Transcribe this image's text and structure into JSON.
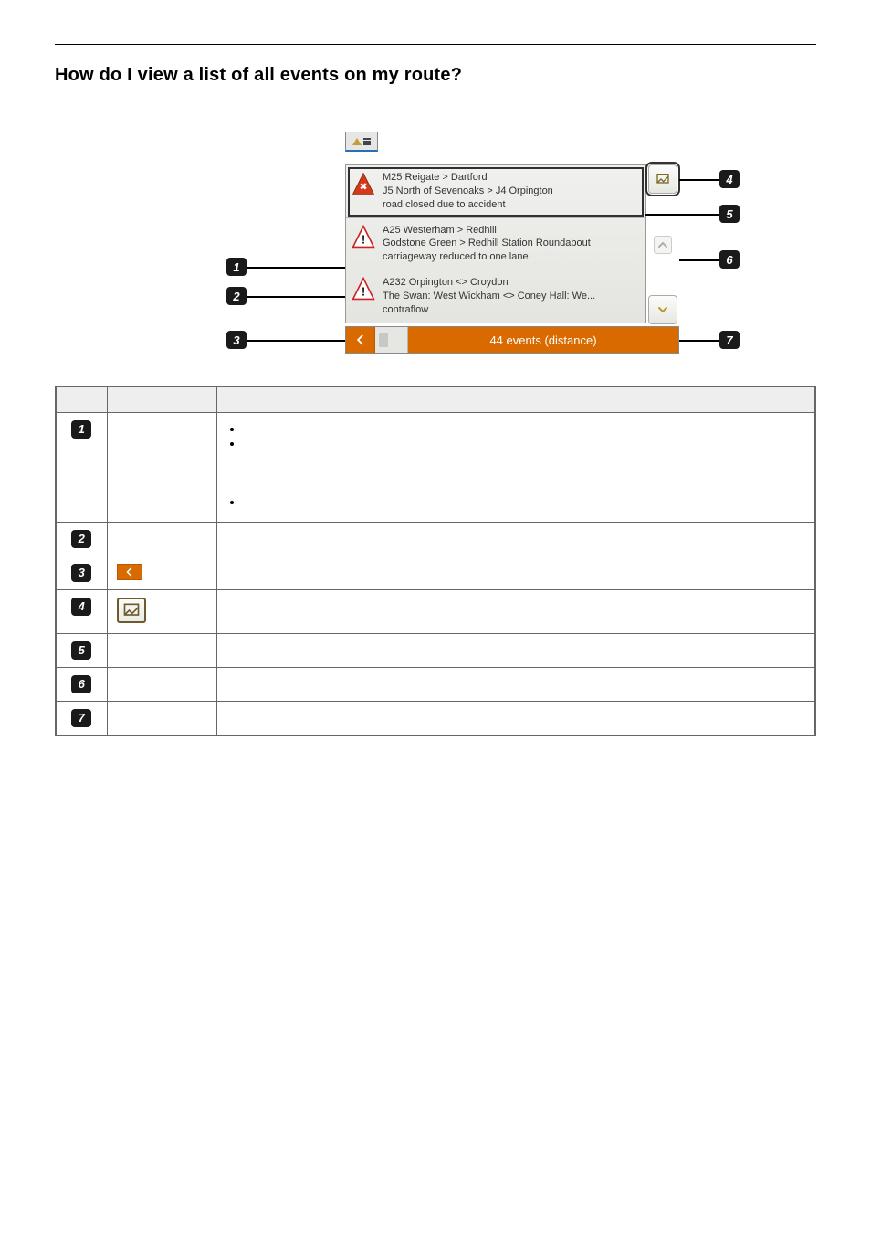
{
  "heading": "How do I view a list of all events on my route?",
  "events": [
    {
      "kind": "accident",
      "line1": "M25 Reigate > Dartford",
      "line2": "J5 North of Sevenoaks > J4 Orpington",
      "line3": "road closed due to accident"
    },
    {
      "kind": "warning",
      "line1": "A25 Westerham > Redhill",
      "line2": "Godstone Green > Redhill Station Roundabout",
      "line3": "carriageway reduced to one lane"
    },
    {
      "kind": "warning",
      "line1": "A232 Orpington <> Croydon",
      "line2": "The Swan: West Wickham <> Coney Hall: We...",
      "line3": "contraflow"
    }
  ],
  "status_text": "44 events (distance)",
  "callouts": [
    "1",
    "2",
    "3",
    "4",
    "5",
    "6",
    "7"
  ],
  "legend_rows": [
    {
      "num": "1"
    },
    {
      "num": "2"
    },
    {
      "num": "3"
    },
    {
      "num": "4"
    },
    {
      "num": "5"
    },
    {
      "num": "6"
    },
    {
      "num": "7"
    }
  ]
}
